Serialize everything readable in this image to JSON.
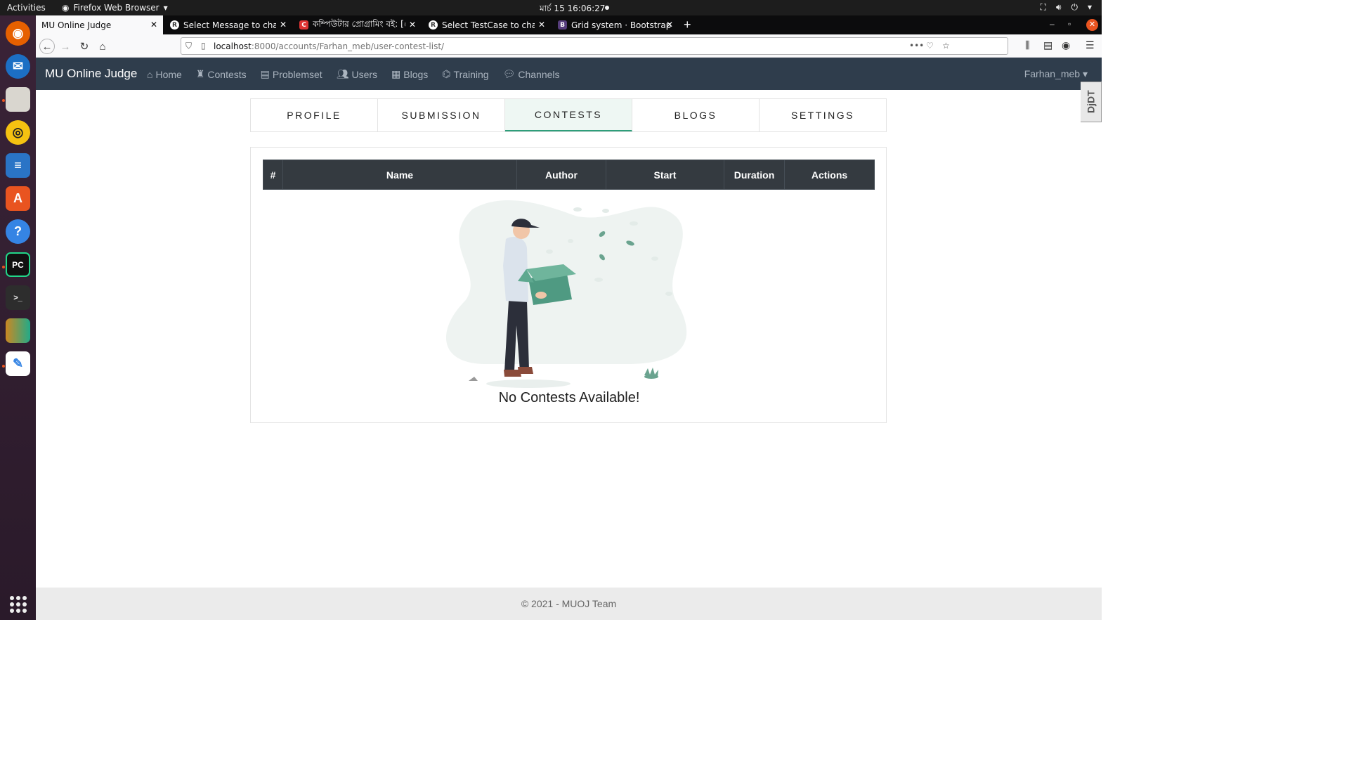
{
  "system": {
    "activities": "Activities",
    "app_menu": "Firefox Web Browser",
    "clock": "মার্চ 15  16:06:27"
  },
  "browser": {
    "tabs": [
      {
        "title": "MU Online Judge"
      },
      {
        "title": "Select Message to chang"
      },
      {
        "title": "কম্পিউটার প্রোগ্রামিং বই: [প্রো"
      },
      {
        "title": "Select TestCase to chang"
      },
      {
        "title": "Grid system · Bootstrap"
      }
    ],
    "url_host": "localhost",
    "url_path": ":8000/accounts/Farhan_meb/user-contest-list/"
  },
  "nav": {
    "brand": "MU Online Judge",
    "links": [
      "Home",
      "Contests",
      "Problemset",
      "Users",
      "Blogs",
      "Training",
      "Channels"
    ],
    "user": "Farhan_meb"
  },
  "profile_tabs": [
    "PROFILE",
    "SUBMISSION",
    "CONTESTS",
    "BLOGS",
    "SETTINGS"
  ],
  "active_tab": "CONTESTS",
  "table": {
    "headers": [
      "#",
      "Name",
      "Author",
      "Start",
      "Duration",
      "Actions"
    ]
  },
  "empty_message": "No Contests Available!",
  "footer": "© 2021 - MUOJ Team",
  "colors": {
    "navbar": "#2f3d4c",
    "table_header": "#343a40",
    "accent": "#2e9e7a"
  }
}
